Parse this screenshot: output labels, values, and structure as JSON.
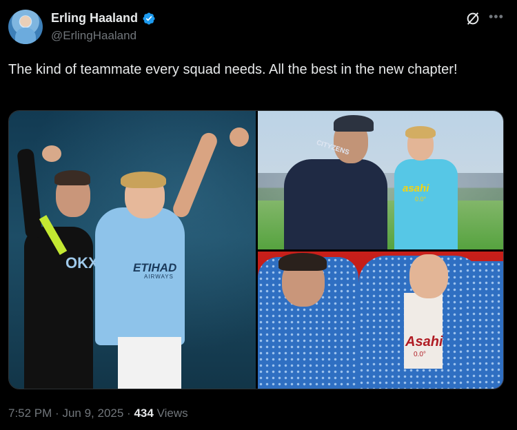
{
  "author": {
    "display_name": "Erling Haaland",
    "handle": "@ErlingHaaland",
    "verified": true,
    "avatar_icon": "avatar-photo"
  },
  "tweet": {
    "text": "The kind of teammate every squad needs. All the best in the new chapter!"
  },
  "media": {
    "photo_count": 3,
    "jersey_text_1": "ETIHAD",
    "jersey_text_1b": "AIRWAYS",
    "jersey_text_2": "CITYZENS",
    "jersey_text_3": "asahi",
    "jersey_text_3b": "0.0°",
    "jersey_text_4": "Asahi",
    "jersey_text_4b": "0.0°",
    "jersey_text_5": "OKX"
  },
  "meta": {
    "time": "7:52 PM",
    "date": "Jun 9, 2025",
    "views_count": "434",
    "views_label": "Views",
    "separator": "·"
  },
  "colors": {
    "background": "#000000",
    "text_primary": "#e7e9ea",
    "text_secondary": "#71767b",
    "verified_blue": "#1d9bf0"
  },
  "icons": {
    "verified": "verified-badge-icon",
    "grok": "grok-icon",
    "more": "more-options-icon"
  }
}
